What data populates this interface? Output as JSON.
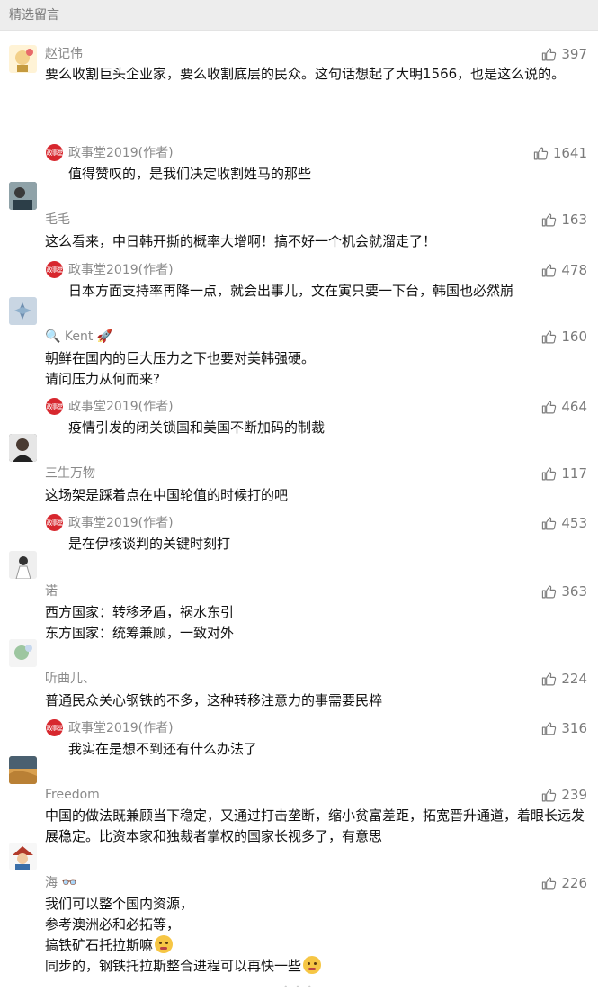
{
  "header": {
    "title": "精选留言"
  },
  "comments": [
    {
      "name": "赵记伟",
      "likes": "397",
      "lines": [
        "要么收割巨头企业家，要么收割底层的民众。这句话想起了大明1566，也是这么说的。"
      ],
      "reply": {
        "name": "政事堂2019(作者)",
        "likes": "1641",
        "text": "值得赞叹的，是我们决定收割姓马的那些"
      }
    },
    {
      "name": "毛毛",
      "likes": "163",
      "lines": [
        "这么看来，中日韩开撕的概率大增啊！搞不好一个机会就溜走了！"
      ],
      "reply": {
        "name": "政事堂2019(作者)",
        "likes": "478",
        "text": "日本方面支持率再降一点，就会出事儿，文在寅只要一下台，韩国也必然崩"
      }
    },
    {
      "name": "🔍 Kent 🚀",
      "likes": "160",
      "lines": [
        "朝鲜在国内的巨大压力之下也要对美韩强硬。",
        "请问压力从何而来?"
      ],
      "reply": {
        "name": "政事堂2019(作者)",
        "likes": "464",
        "text": "疫情引发的闭关锁国和美国不断加码的制裁"
      }
    },
    {
      "name": "三生万物",
      "likes": "117",
      "lines": [
        "这场架是踩着点在中国轮值的时候打的吧"
      ],
      "reply": {
        "name": "政事堂2019(作者)",
        "likes": "453",
        "text": "是在伊核谈判的关键时刻打"
      }
    },
    {
      "name": "诺",
      "likes": "363",
      "lines": [
        "西方国家：转移矛盾，祸水东引",
        "东方国家：统筹兼顾，一致对外"
      ]
    },
    {
      "name": "听曲儿、",
      "likes": "224",
      "lines": [
        "普通民众关心钢铁的不多，这种转移注意力的事需要民粹"
      ],
      "reply": {
        "name": "政事堂2019(作者)",
        "likes": "316",
        "text": "我实在是想不到还有什么办法了"
      }
    },
    {
      "name": "Freedom",
      "likes": "239",
      "lines": [
        "中国的做法既兼顾当下稳定，又通过打击垄断，缩小贫富差距，拓宽晋升通道，着眼长远发展稳定。比资本家和独裁者掌权的国家长视多了，有意思"
      ]
    },
    {
      "name": "海 👓",
      "likes": "226",
      "lines": [
        "我们可以整个国内资源，",
        "参考澳洲必和必拓等，",
        "搞铁矿石托拉斯嘛",
        "同步的，钢铁托拉斯整合进程可以再快一些"
      ]
    }
  ],
  "reply_avatar_text": "政事堂"
}
